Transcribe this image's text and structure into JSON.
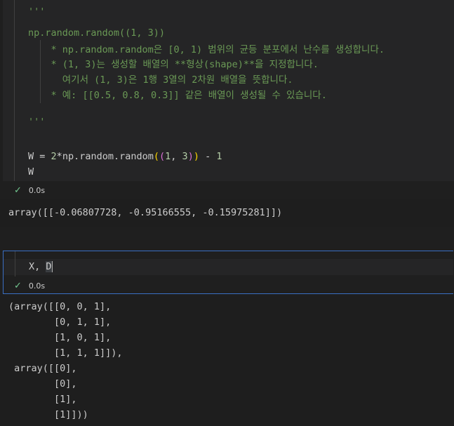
{
  "cell1": {
    "code_lines": [
      "'''",
      "np.random.random((1, 3))",
      "    * np.random.random은 [0, 1) 범위의 균등 분포에서 난수를 생성합니다.",
      "    * (1, 3)는 생성할 배열의 **형상(shape)**을 지정합니다.",
      "      여기서 (1, 3)은 1행 3열의 2차원 배열을 뜻합니다.",
      "    * 예: [[0.5, 0.8, 0.3]] 같은 배열이 생성될 수 있습니다.",
      "",
      "'''",
      "",
      "W = 2*np.random.random((1, 3)) - 1",
      "W"
    ],
    "code_tokens": {
      "w_var": "W",
      "eq": " = ",
      "two": "2",
      "star": "*",
      "call": "np.random.random",
      "open_outer": "(",
      "open_inner": "(",
      "one": "1",
      "comma": ", ",
      "three": "3",
      "close_inner": ")",
      "close_outer": ")",
      "minus": " - ",
      "one_b": "1"
    },
    "status_time": "0.0s",
    "output": "array([[-0.06807728, -0.95166555, -0.15975281]])"
  },
  "cell2": {
    "code": "X, D",
    "code_x": "X, ",
    "code_d": "D",
    "status_time": "0.0s",
    "output_lines": [
      "(array([[0, 0, 1],",
      "        [0, 1, 1],",
      "        [1, 0, 1],",
      "        [1, 1, 1]]),",
      " array([[0],",
      "        [0],",
      "        [1],",
      "        [1]]))"
    ]
  },
  "icons": {
    "success": "check-icon"
  },
  "colors": {
    "docstring": "#6a9955",
    "accent_border": "#3a6fc4",
    "check": "#73c991"
  }
}
